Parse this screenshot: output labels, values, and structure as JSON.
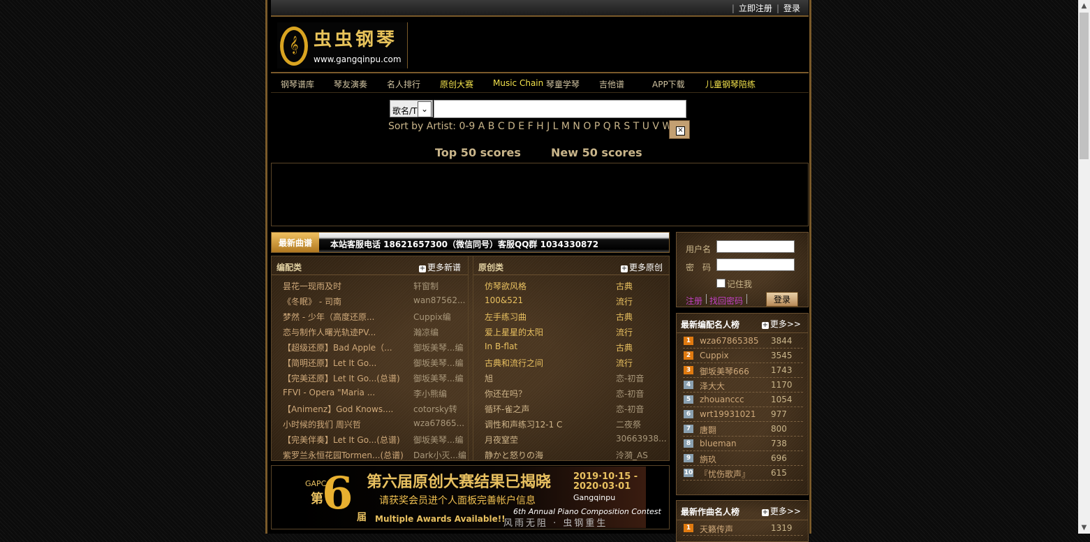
{
  "topbar": {
    "register": "立即注册",
    "login": "登录"
  },
  "logo": {
    "title": "虫虫钢琴",
    "url": "www.gangqinpu.com",
    "clef": "𝄞"
  },
  "nav": [
    {
      "label": "钢琴谱库",
      "hl": false
    },
    {
      "label": "琴友演奏",
      "hl": false
    },
    {
      "label": "名人排行",
      "hl": false
    },
    {
      "label": "原创大赛",
      "hl": true
    },
    {
      "label": "Music Chain",
      "hl": true
    },
    {
      "label": "琴童学琴",
      "hl": false
    },
    {
      "label": "吉他谱",
      "hl": false
    },
    {
      "label": "APP下载",
      "hl": false
    },
    {
      "label": "儿童钢琴陪练",
      "hl": true
    }
  ],
  "search": {
    "select_value": "歌名/Ti",
    "input_value": ""
  },
  "sortby": {
    "label": "Sort by Artist:",
    "letters": "0-9 A B C D E F H J L M N O P Q R S T U V W"
  },
  "scores": {
    "top": "Top 50 scores",
    "new": "New  50 scores"
  },
  "news": {
    "tag": "最新曲谱",
    "text": "本站客服电话 18621657300（微信同号）客服QQ群 1034330872"
  },
  "left_col": {
    "title": "编配类",
    "more": "更多新谱",
    "rows": [
      {
        "name": "昙花一现雨及时",
        "author": "轩窗制"
      },
      {
        "name": "《冬眠》 - 司南",
        "author": "wan87562..."
      },
      {
        "name": "梦然 - 少年（高度还原...",
        "author": "Cuppix编"
      },
      {
        "name": "恋与制作人曙光轨迹PV...",
        "author": "瀚凉编"
      },
      {
        "name": "【超级还原】Bad Apple（...",
        "author": "御坂美琴...编"
      },
      {
        "name": "【简明还原】Let It Go...",
        "author": "御坂美琴...编"
      },
      {
        "name": "【完美还原】Let It Go...(总谱)",
        "author": "御坂美琴...编"
      },
      {
        "name": "FFVI - Opera \"Maria ...",
        "author": "李小熊编"
      },
      {
        "name": "【Animenz】God Knows....",
        "author": "cotorsky转"
      },
      {
        "name": "小时候的我们 周兴哲",
        "author": "wza67865..."
      },
      {
        "name": "【完美伴奏】Let It Go...(总谱)",
        "author": "御坂美琴...编"
      },
      {
        "name": "紫罗兰永恒花园Tormen...(总谱)",
        "author": "Dark小灭...编"
      }
    ]
  },
  "right_col": {
    "title": "原创类",
    "more": "更多原创",
    "rows": [
      {
        "name": "仿琴欲风格",
        "author": "古典",
        "dim": false
      },
      {
        "name": "100&521",
        "author": "流行",
        "dim": false
      },
      {
        "name": "左手练习曲",
        "author": "古典",
        "dim": false
      },
      {
        "name": "爱上星星的太阳",
        "author": "流行",
        "dim": false
      },
      {
        "name": "In B-flat",
        "author": "古典",
        "dim": false
      },
      {
        "name": "古典和流行之间",
        "author": "流行",
        "dim": false
      },
      {
        "name": "旭",
        "author": "恋-初音",
        "dim": true
      },
      {
        "name": "你还在吗？",
        "author": "恋-初音",
        "dim": true
      },
      {
        "name": "循环-雀之声",
        "author": "恋-初音",
        "dim": true
      },
      {
        "name": "调性和声练习12-1 C",
        "author": "二夜祭",
        "dim": true
      },
      {
        "name": "月夜窒茔",
        "author": "30663938...",
        "dim": true
      },
      {
        "name": "静かと怒りの海",
        "author": "泠漪_AS",
        "dim": true
      }
    ]
  },
  "banner": {
    "gapcc": "GAPCC",
    "di": "第",
    "six": "6",
    "jie": "届",
    "title": "第六届原创大赛结果已揭晓",
    "sub": "请获奖会员进个人面板完善帐户信息",
    "date1": "2019·10·15 -",
    "date2": "2020·03·01",
    "gq": "Gangqinpu",
    "contest": "6th Annual Piano Composition Contest",
    "multi": "Multiple Awards Available!!",
    "motto": "风雨无阻 · 虫钢重生"
  },
  "login": {
    "user_label": "用户名",
    "pass_label": "密　码",
    "remember": "记住我",
    "register": "注册",
    "forgot": "找回密码",
    "submit": "登录"
  },
  "rank1": {
    "title": "最新编配名人榜",
    "more": "更多>>",
    "items": [
      {
        "n": "1",
        "name": "wza67865385",
        "score": "3844"
      },
      {
        "n": "2",
        "name": "Cuppix",
        "score": "3545"
      },
      {
        "n": "3",
        "name": "御坂美琴666",
        "score": "1743"
      },
      {
        "n": "4",
        "name": "泽大大",
        "score": "1170"
      },
      {
        "n": "5",
        "name": "zhouanccc",
        "score": "1054"
      },
      {
        "n": "6",
        "name": "wrt19931021",
        "score": "977"
      },
      {
        "n": "7",
        "name": "唐翾",
        "score": "800"
      },
      {
        "n": "8",
        "name": "blueman",
        "score": "738"
      },
      {
        "n": "9",
        "name": "旃玖",
        "score": "696"
      },
      {
        "n": "10",
        "name": "『忧伤歌声』",
        "score": "615"
      }
    ]
  },
  "rank2": {
    "title": "最新作曲名人榜",
    "more": "更多>>",
    "items": [
      {
        "n": "1",
        "name": "天籁传声",
        "score": "1319"
      }
    ]
  }
}
